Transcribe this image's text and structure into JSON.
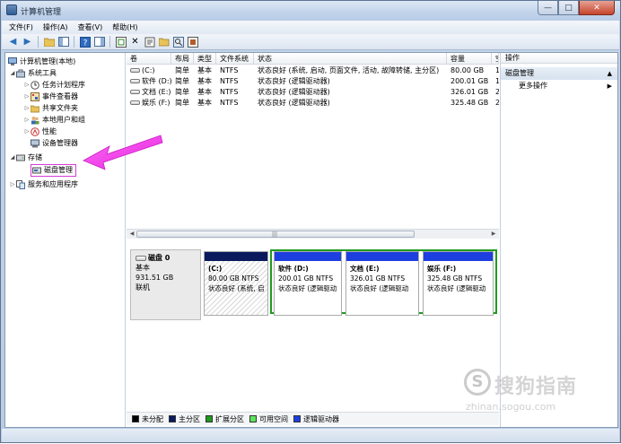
{
  "window": {
    "title": "计算机管理"
  },
  "menu": [
    "文件(F)",
    "操作(A)",
    "查看(V)",
    "帮助(H)"
  ],
  "toolbar": {
    "icons": [
      "back-icon",
      "forward-icon",
      "up-folder-icon",
      "show-hide-tree-icon",
      "help-icon",
      "view-icon",
      "refresh-icon",
      "delete-icon",
      "properties-icon",
      "open-icon",
      "search-icon",
      "export-icon"
    ]
  },
  "tree": {
    "root": "计算机管理(本地)",
    "system_tools": "系统工具",
    "task_scheduler": "任务计划程序",
    "event_viewer": "事件查看器",
    "shared_folders": "共享文件夹",
    "local_users": "本地用户和组",
    "performance": "性能",
    "device_manager": "设备管理器",
    "storage": "存储",
    "disk_management": "磁盘管理",
    "services_apps": "服务和应用程序"
  },
  "volumes": {
    "columns": [
      "卷",
      "布局",
      "类型",
      "文件系统",
      "状态",
      "容量",
      "空"
    ],
    "rows": [
      [
        "(C:)",
        "简单",
        "基本",
        "NTFS",
        "状态良好 (系统, 启动, 页面文件, 活动, 故障转储, 主分区)",
        "80.00 GB",
        "1"
      ],
      [
        "软件 (D:)",
        "简单",
        "基本",
        "NTFS",
        "状态良好 (逻辑驱动器)",
        "200.01 GB",
        "1"
      ],
      [
        "文档 (E:)",
        "简单",
        "基本",
        "NTFS",
        "状态良好 (逻辑驱动器)",
        "326.01 GB",
        "2"
      ],
      [
        "娱乐 (F:)",
        "简单",
        "基本",
        "NTFS",
        "状态良好 (逻辑驱动器)",
        "325.48 GB",
        "2"
      ]
    ]
  },
  "disk": {
    "name": "磁盘 0",
    "type": "基本",
    "size": "931.51 GB",
    "state": "联机",
    "partitions": [
      {
        "name": "(C:)",
        "size": "80.00 GB NTFS",
        "status": "状态良好 (系统, 启",
        "bar_color": "#0a1a5c"
      },
      {
        "name": "软件 (D:)",
        "size": "200.01 GB NTFS",
        "status": "状态良好 (逻辑驱动",
        "bar_color": "#1d3fe0"
      },
      {
        "name": "文档 (E:)",
        "size": "326.01 GB NTFS",
        "status": "状态良好 (逻辑驱动",
        "bar_color": "#1d3fe0"
      },
      {
        "name": "娱乐 (F:)",
        "size": "325.48 GB NTFS",
        "status": "状态良好 (逻辑驱动",
        "bar_color": "#1d3fe0"
      }
    ]
  },
  "legend": [
    {
      "label": "未分配",
      "color": "#000000"
    },
    {
      "label": "主分区",
      "color": "#0a1a5c"
    },
    {
      "label": "扩展分区",
      "color": "#1f9a1f"
    },
    {
      "label": "可用空间",
      "color": "#5fe35f"
    },
    {
      "label": "逻辑驱动器",
      "color": "#1d3fe0"
    }
  ],
  "actions": {
    "header": "操作",
    "section": "磁盘管理",
    "more": "更多操作"
  },
  "watermark": {
    "logo": "S",
    "text": "搜狗指南",
    "url": "zhinan.sogou.com"
  }
}
